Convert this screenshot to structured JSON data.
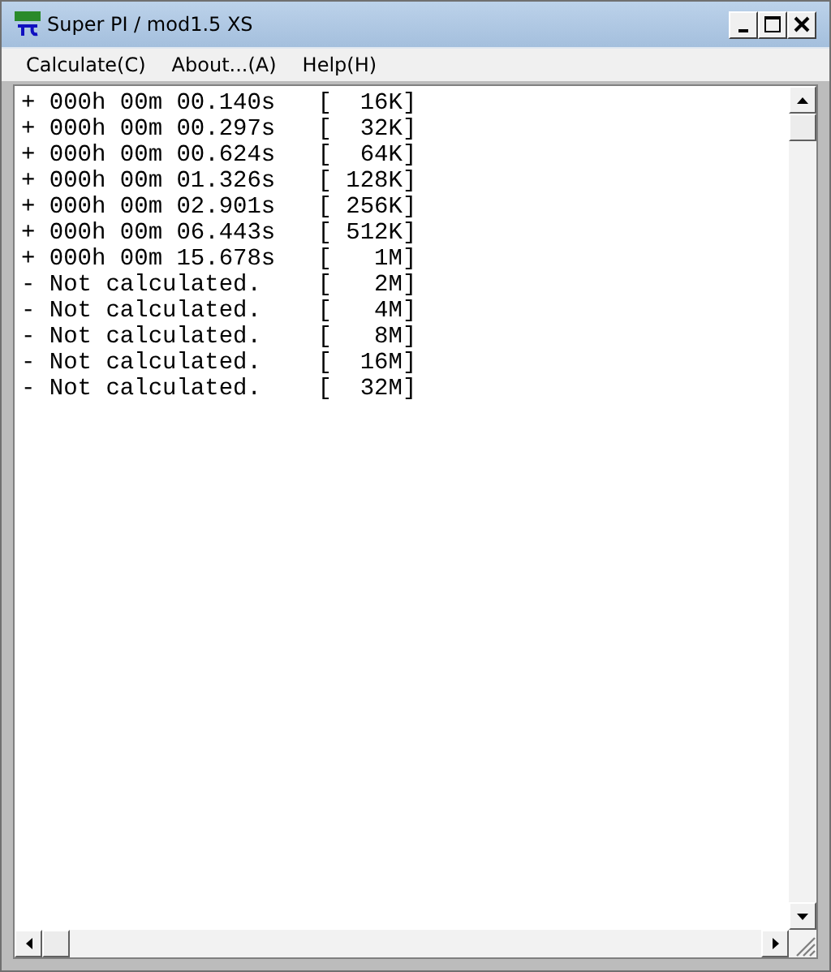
{
  "window": {
    "title": "Super PI / mod1.5 XS"
  },
  "menu": [
    {
      "label": "Calculate(C)"
    },
    {
      "label": "About...(A)"
    },
    {
      "label": "Help(H)"
    }
  ],
  "results": [
    "+ 000h 00m 00.140s   [  16K]",
    "+ 000h 00m 00.297s   [  32K]",
    "+ 000h 00m 00.624s   [  64K]",
    "+ 000h 00m 01.326s   [ 128K]",
    "+ 000h 00m 02.901s   [ 256K]",
    "+ 000h 00m 06.443s   [ 512K]",
    "+ 000h 00m 15.678s   [   1M]",
    "- Not calculated.    [   2M]",
    "- Not calculated.    [   4M]",
    "- Not calculated.    [   8M]",
    "- Not calculated.    [  16M]",
    "- Not calculated.    [  32M]"
  ]
}
